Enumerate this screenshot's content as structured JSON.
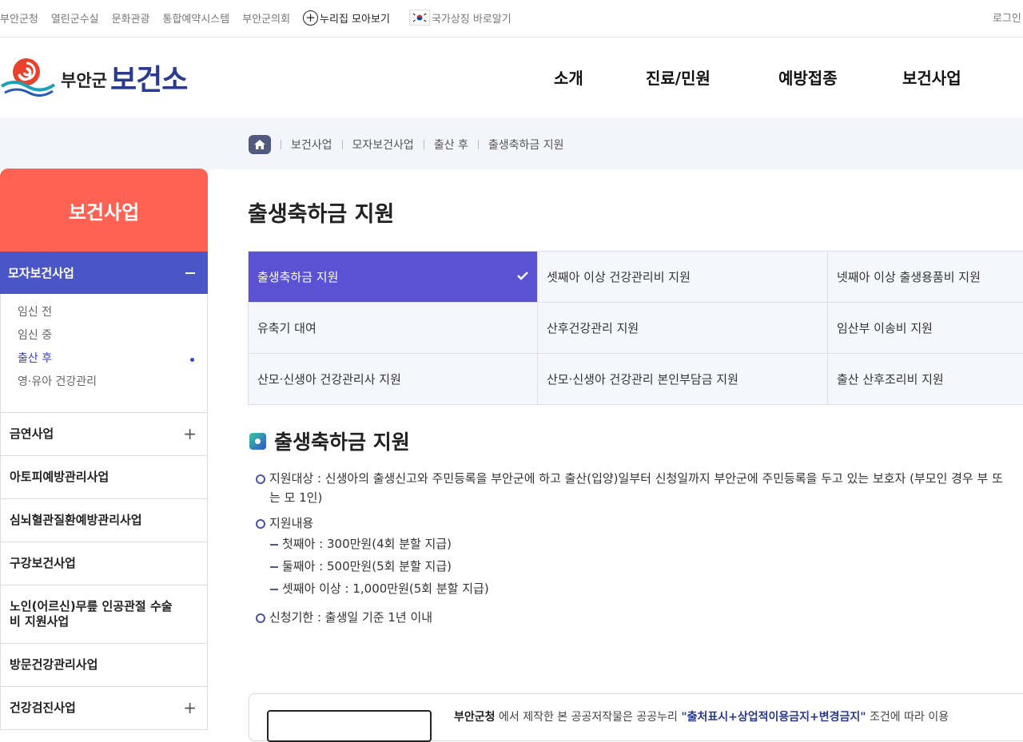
{
  "topbar": {
    "links": [
      "부안군청",
      "열린군수실",
      "문화관광",
      "통합예약시스템",
      "부안군의회"
    ],
    "nuri": "누리집 모아보기",
    "flag": "국가상징 바로알기",
    "login": "로그인"
  },
  "logo": {
    "t1": "부안군",
    "t2": "보건소"
  },
  "gnb": [
    "소개",
    "진료/민원",
    "예방접종",
    "보건사업"
  ],
  "breadcrumb": [
    "보건사업",
    "모자보건사업",
    "출산 후",
    "출생축하금 지원"
  ],
  "sidebar": {
    "title": "보건사업",
    "active": "모자보건사업",
    "sub": [
      {
        "label": "임신 전",
        "on": false
      },
      {
        "label": "임신 중",
        "on": false
      },
      {
        "label": "출산 후",
        "on": true
      },
      {
        "label": "영·유아 건강관리",
        "on": false
      }
    ],
    "menu": [
      {
        "label": "금연사업",
        "expand": true
      },
      {
        "label": "아토피예방관리사업",
        "expand": false
      },
      {
        "label": "심뇌혈관질환예방관리사업",
        "expand": false
      },
      {
        "label": "구강보건사업",
        "expand": false
      },
      {
        "label": "노인(어르신)무릎 인공관절 수술비 지원사업",
        "expand": false
      },
      {
        "label": "방문건강관리사업",
        "expand": false
      },
      {
        "label": "건강검진사업",
        "expand": true
      }
    ]
  },
  "page_title": "출생축하금 지원",
  "tabs": [
    [
      "출생축하금 지원",
      "셋째아 이상 건강관리비 지원",
      "넷째아 이상 출생용품비 지원"
    ],
    [
      "유축기 대여",
      "산후건강관리 지원",
      "임산부 이송비 지원"
    ],
    [
      "산모·신생아 건강관리사 지원",
      "산모·신생아 건강관리 본인부담금 지원",
      "출산 산후조리비 지원"
    ]
  ],
  "section_title": "출생축하금 지원",
  "content": {
    "target": "지원대상 : 신생아의 출생신고와 주민등록을 부안군에 하고 출산(입양)일부터 신청일까지 부안군에 주민등록을 두고 있는 보호자 (부모인 경우 부 또는 모 1인)",
    "support": "지원내용",
    "items": [
      "첫째아 : 300만원(4회 분할 지급)",
      "둘째아 : 500만원(5회 분할 지급)",
      "셋째아 이상 : 1,000만원(5회 분할 지급)"
    ],
    "deadline": "신청기한 : 출생일 기준 1년 이내"
  },
  "license": {
    "org": "부안군청",
    "pre": " 에서 제작한 본 공공저작물은 공공누리 ",
    "type": "\"출처표시+상업적이용금지+변경금지\"",
    "post": " 조건에 따라 이용"
  },
  "colors": {
    "accent": "#5a52d2",
    "sidebar_title": "#ff6252",
    "sidebar_active": "#4a55c6",
    "brand": "#2a3a8c"
  }
}
